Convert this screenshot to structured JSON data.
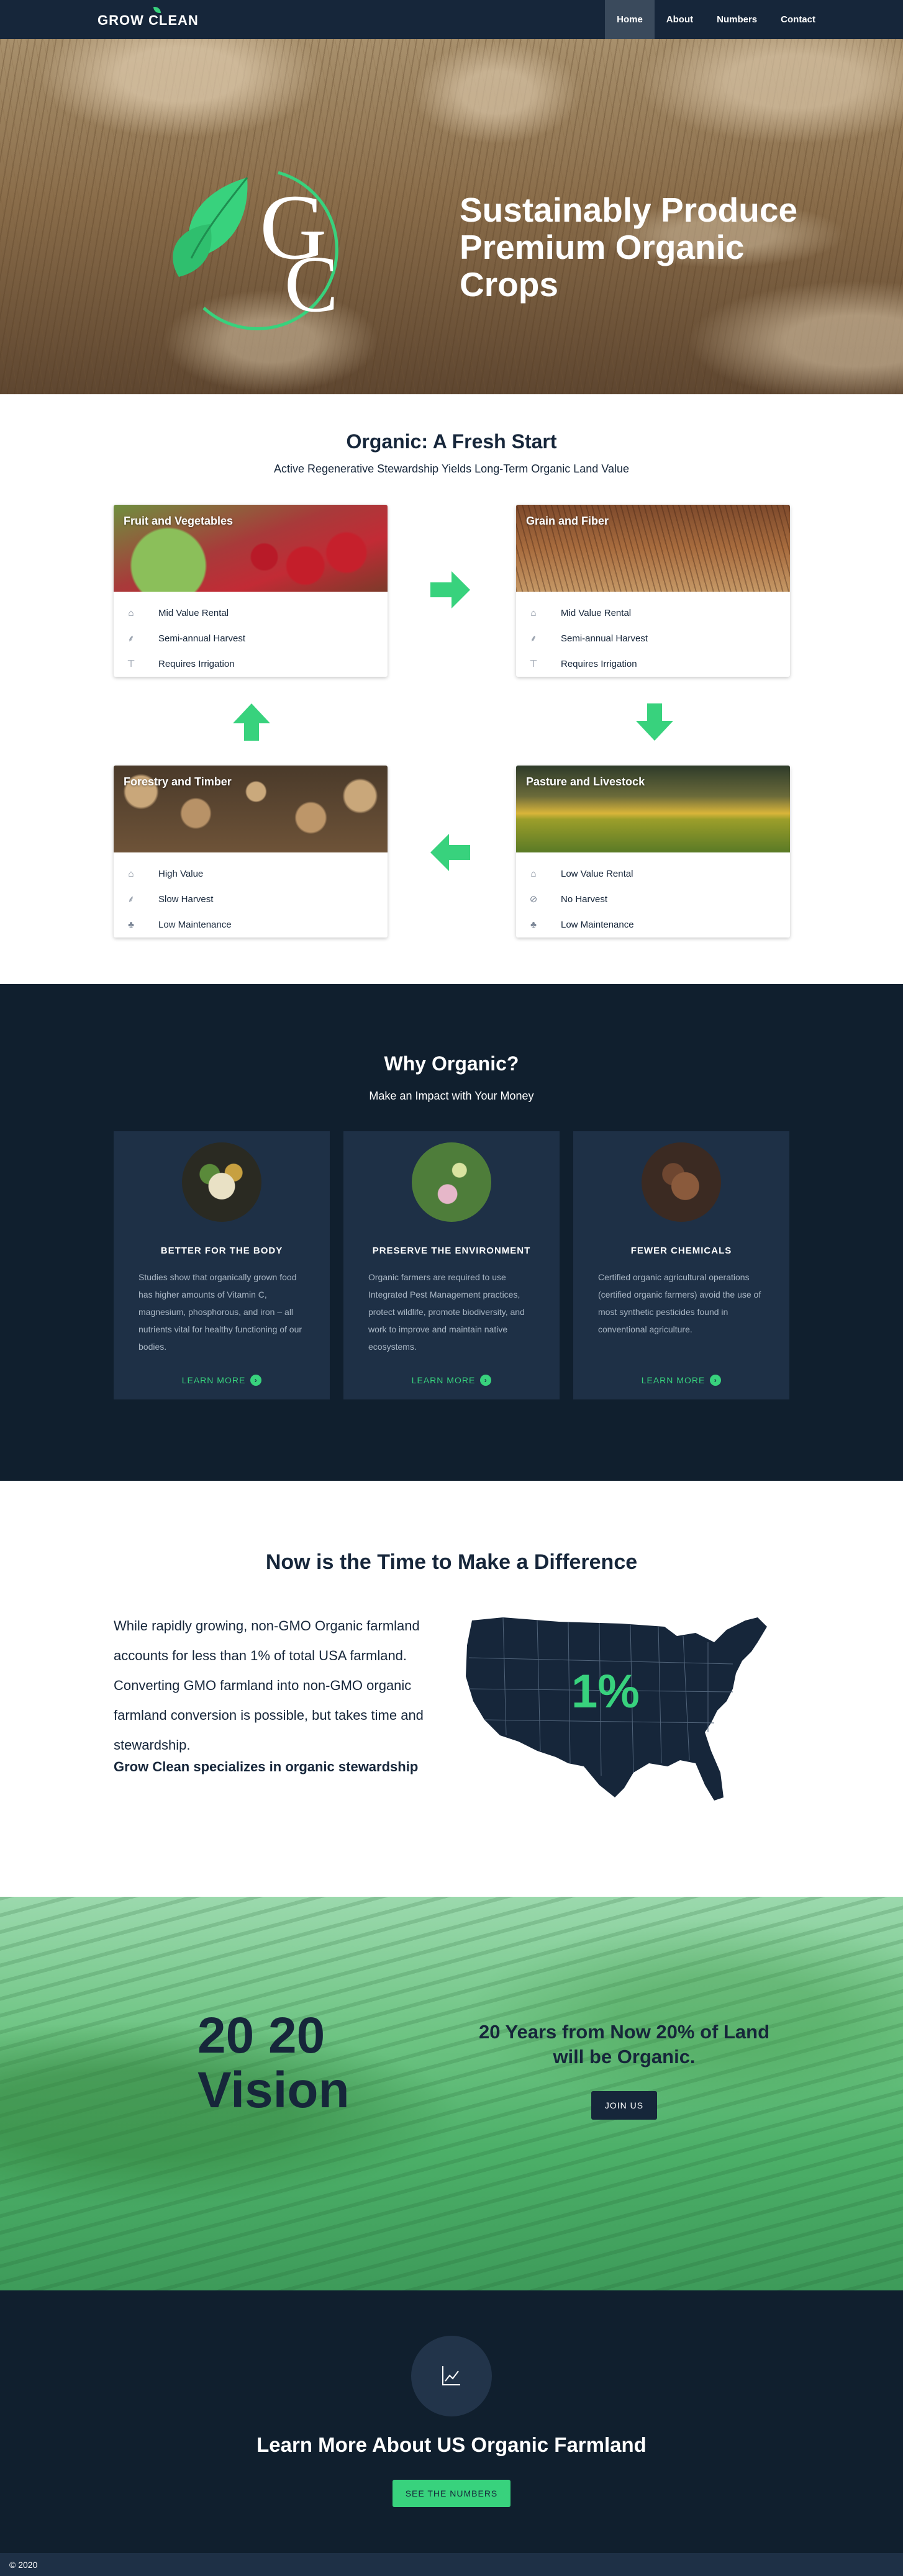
{
  "nav": {
    "brand": "GROW CLEAN",
    "links": [
      "Home",
      "About",
      "Numbers",
      "Contact"
    ],
    "active": "Home"
  },
  "hero": {
    "logo_letters": "GC",
    "title": "Sustainably Produce Premium Organic Crops"
  },
  "fresh": {
    "title": "Organic: A Fresh Start",
    "subtitle": "Active Regenerative Stewardship Yields Long-Term Organic Land Value",
    "cards": [
      {
        "title": "Fruit and Vegetables",
        "items": [
          {
            "icon": "home-icon",
            "text": "Mid Value Rental"
          },
          {
            "icon": "wheat-icon",
            "text": "Semi-annual Harvest"
          },
          {
            "icon": "faucet-icon",
            "text": "Requires Irrigation"
          }
        ]
      },
      {
        "title": "Grain and Fiber",
        "items": [
          {
            "icon": "home-icon",
            "text": "Mid Value Rental"
          },
          {
            "icon": "wheat-icon",
            "text": "Semi-annual Harvest"
          },
          {
            "icon": "faucet-icon",
            "text": "Requires Irrigation"
          }
        ]
      },
      {
        "title": "Forestry and Timber",
        "items": [
          {
            "icon": "home-icon",
            "text": "High Value"
          },
          {
            "icon": "wheat-icon",
            "text": "Slow Harvest"
          },
          {
            "icon": "seedling-icon",
            "text": "Low Maintenance"
          }
        ]
      },
      {
        "title": "Pasture and Livestock",
        "items": [
          {
            "icon": "home-icon",
            "text": "Low Value Rental"
          },
          {
            "icon": "no-wheat-icon",
            "text": "No Harvest"
          },
          {
            "icon": "seedling-icon",
            "text": "Low Maintenance"
          }
        ]
      }
    ]
  },
  "why": {
    "title": "Why Organic?",
    "subtitle": "Make an Impact with Your Money",
    "cards": [
      {
        "heading": "BETTER FOR THE BODY",
        "text": "Studies show that organically grown food has higher amounts of Vitamin C, magnesium, phosphorous, and iron – all nutrients vital for healthy functioning of our bodies.",
        "link": "LEARN MORE"
      },
      {
        "heading": "PRESERVE THE ENVIRONMENT",
        "text": "Organic farmers are required to use Integrated Pest Management practices, protect wildlife, promote biodiversity, and work to improve and maintain native ecosystems.",
        "link": "LEARN MORE"
      },
      {
        "heading": "FEWER CHEMICALS",
        "text": "Certified organic agricultural operations (certified organic farmers) avoid the use of most synthetic pesticides found in conventional agriculture.",
        "link": "LEARN MORE"
      }
    ]
  },
  "difference": {
    "title": "Now is the Time to Make a Difference",
    "body": "While rapidly growing, non-GMO Organic farmland accounts for less than 1% of total USA farmland. Converting GMO farmland into non-GMO organic farmland conversion is possible, but takes time and stewardship.",
    "bold": "Grow Clean specializes in organic stewardship",
    "map_label": "1%"
  },
  "vision": {
    "big_line1": "20 20",
    "big_line2": "Vision",
    "headline": "20 Years from Now 20% of Land will be Organic.",
    "button": "JOIN US"
  },
  "learn": {
    "title": "Learn More About US Organic Farmland",
    "button": "SEE THE NUMBERS"
  },
  "footer": {
    "text": "© 2020"
  },
  "colors": {
    "navy": "#16263a",
    "dark": "#101f2e",
    "green": "#38d27d"
  }
}
